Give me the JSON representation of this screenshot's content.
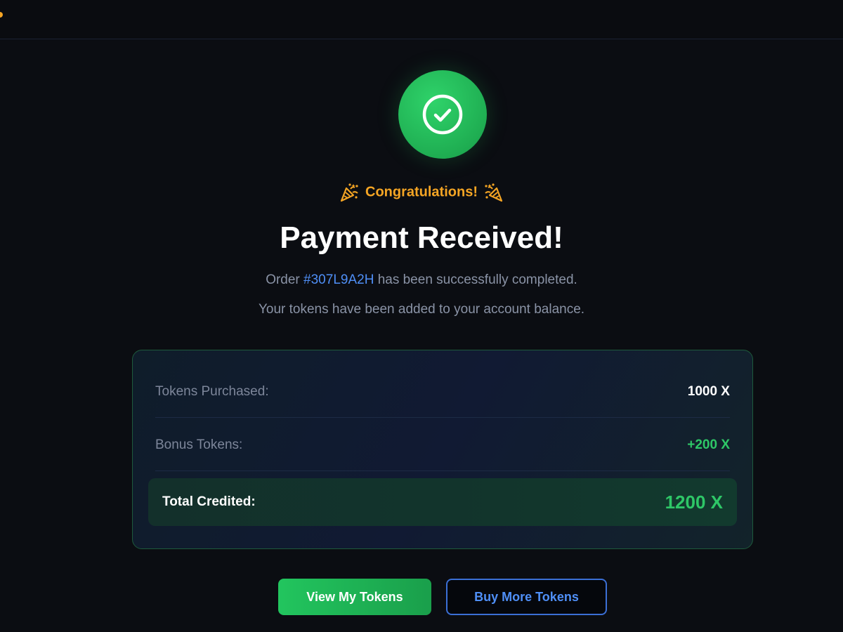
{
  "header": {
    "edge_mark_color": "#f5a524"
  },
  "status": {
    "icon": "check-circle-icon",
    "color": "#22c55e"
  },
  "congrats": {
    "text": "Congratulations!",
    "color": "#f5a524",
    "icon": "party-popper-icon"
  },
  "title": "Payment Received!",
  "message": {
    "prefix": "Order",
    "order_id": "#307L9A2H",
    "suffix": "has been successfully completed.",
    "line2": "Your tokens have been added to your account balance."
  },
  "summary": {
    "rows": [
      {
        "label": "Tokens Purchased:",
        "value": "1000 X"
      },
      {
        "label": "Bonus Tokens:",
        "value": "+200 X"
      }
    ],
    "total": {
      "label": "Total Credited:",
      "value": "1200 X"
    }
  },
  "actions": {
    "primary_label": "View My Tokens",
    "secondary_label": "Buy More Tokens"
  },
  "colors": {
    "accent_green": "#22c55e",
    "accent_blue": "#4f8ff7",
    "accent_orange": "#f5a524",
    "background": "#0b0d12"
  }
}
